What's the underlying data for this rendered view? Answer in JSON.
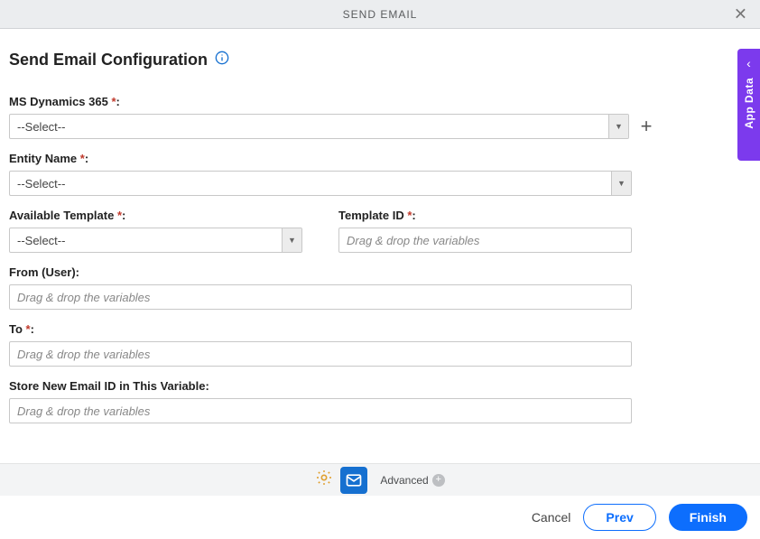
{
  "header": {
    "title": "SEND EMAIL"
  },
  "page": {
    "title": "Send Email Configuration"
  },
  "fields": {
    "msdynamics": {
      "label": "MS Dynamics 365",
      "required": true,
      "value": "--Select--"
    },
    "entityName": {
      "label": "Entity Name",
      "required": true,
      "value": "--Select--"
    },
    "availableTemplate": {
      "label": "Available Template",
      "required": true,
      "value": "--Select--"
    },
    "templateId": {
      "label": "Template ID",
      "required": true,
      "placeholder": "Drag & drop the variables"
    },
    "fromUser": {
      "label": "From (User):",
      "placeholder": "Drag & drop the variables"
    },
    "to": {
      "label": "To",
      "required": true,
      "placeholder": "Drag & drop the variables"
    },
    "storeVar": {
      "label": "Store New Email ID in This Variable:",
      "placeholder": "Drag & drop the variables"
    }
  },
  "sideTab": {
    "label": "App Data"
  },
  "toolbar": {
    "advanced": "Advanced"
  },
  "footer": {
    "cancel": "Cancel",
    "prev": "Prev",
    "finish": "Finish"
  }
}
